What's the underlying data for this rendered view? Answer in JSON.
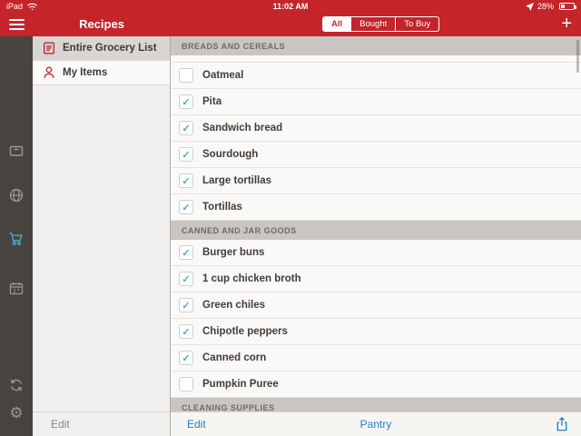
{
  "status_bar": {
    "device": "iPad",
    "time": "11:02 AM",
    "battery_percent": "28%"
  },
  "nav": {
    "title": "Recipes",
    "segments": [
      {
        "label": "All",
        "selected": true
      },
      {
        "label": "Bought",
        "selected": false
      },
      {
        "label": "To Buy",
        "selected": false
      }
    ],
    "add_label": "+"
  },
  "rail": {
    "icons": [
      {
        "name": "recipe-box",
        "active": false
      },
      {
        "name": "globe",
        "active": false
      },
      {
        "name": "cart",
        "active": true
      },
      {
        "name": "calendar",
        "active": false
      },
      {
        "name": "sync",
        "active": false
      },
      {
        "name": "gear",
        "active": false
      }
    ]
  },
  "left_panel": {
    "items": [
      {
        "label": "Entire Grocery List",
        "icon": "list",
        "selected": true
      },
      {
        "label": "My Items",
        "icon": "person",
        "selected": false
      }
    ],
    "edit_label": "Edit"
  },
  "grocery": {
    "sections": [
      {
        "title": "BREADS AND CEREALS",
        "partial_row_top": true,
        "items": [
          {
            "label": "Oatmeal",
            "checked": false
          },
          {
            "label": "Pita",
            "checked": true
          },
          {
            "label": "Sandwich bread",
            "checked": true
          },
          {
            "label": "Sourdough",
            "checked": true
          },
          {
            "label": "Large tortillas",
            "checked": true
          },
          {
            "label": "Tortillas",
            "checked": true
          }
        ]
      },
      {
        "title": "CANNED AND JAR GOODS",
        "partial_row_top": false,
        "items": [
          {
            "label": "Burger buns",
            "checked": true
          },
          {
            "label": "1 cup chicken broth",
            "checked": true
          },
          {
            "label": "Green chiles",
            "checked": true
          },
          {
            "label": "Chipotle peppers",
            "checked": true
          },
          {
            "label": "Canned corn",
            "checked": true
          },
          {
            "label": "Pumpkin Puree",
            "checked": false
          }
        ]
      },
      {
        "title": "CLEANING SUPPLIES",
        "partial_row_top": false,
        "items": []
      }
    ]
  },
  "toolbar": {
    "edit_label": "Edit",
    "pantry_label": "Pantry"
  },
  "colors": {
    "red": "#c5242b",
    "teal_check": "#45aec6",
    "rail_active_blue": "#4aa6c9",
    "link_blue": "#1b82c6"
  }
}
